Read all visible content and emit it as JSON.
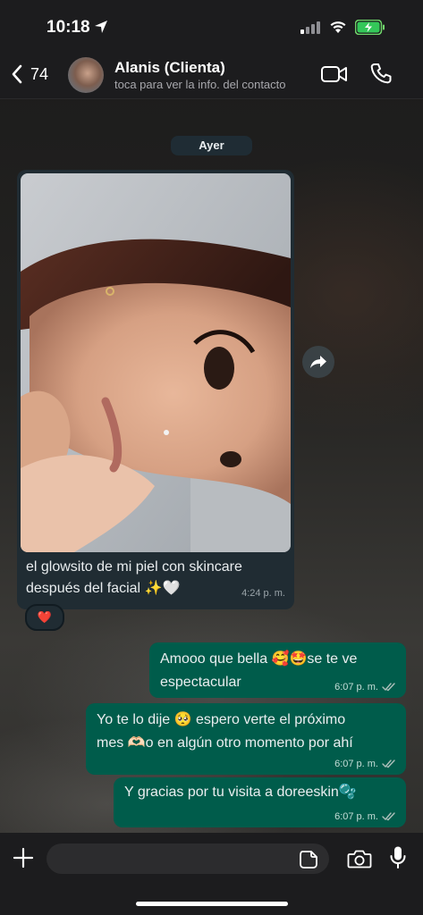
{
  "status_bar": {
    "time": "10:18"
  },
  "header": {
    "back_count": "74",
    "contact_name": "Alanis (Clienta)",
    "contact_subtitle": "toca para ver la info. del contacto"
  },
  "date_separator": "Ayer",
  "incoming_message": {
    "text_line1": "el glowsito de mi piel con skincare",
    "text_line2": "después del facial ✨🤍",
    "time": "4:24 p. m.",
    "reaction": "❤️"
  },
  "outgoing_messages": [
    {
      "line1": "Amooo que bella 🥰🤩se te ve",
      "line2": "espectacular",
      "time": "6:07 p. m."
    },
    {
      "line1": "Yo te lo dije 🥺 espero verte el próximo",
      "line2": "mes 🫶🏻o en algún otro momento por ahí",
      "time": "6:07 p. m."
    },
    {
      "line1": "Y gracias por tu visita a doreeskin🫧",
      "time": "6:07 p. m."
    }
  ],
  "composer": {
    "placeholder": ""
  },
  "colors": {
    "outgoing_bubble": "#005c4b",
    "incoming_bubble": "#202c33",
    "accent": "#53bdeb"
  }
}
